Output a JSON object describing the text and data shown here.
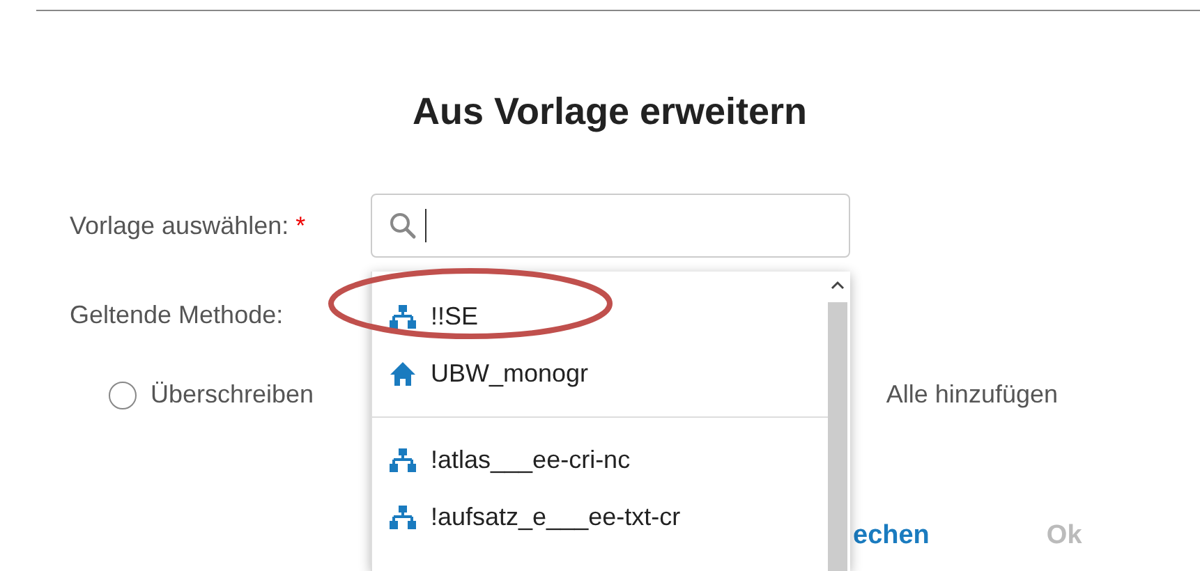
{
  "dialog": {
    "title": "Aus Vorlage erweitern"
  },
  "template_field": {
    "label": "Vorlage auswählen:",
    "required_mark": "*"
  },
  "dropdown": {
    "items": [
      {
        "kind": "tree",
        "label": "!!SE",
        "circled": true
      },
      {
        "kind": "home",
        "label": "UBW_monogr",
        "circled": false
      },
      {
        "kind": "separator"
      },
      {
        "kind": "tree",
        "label": "!atlas___ee-cri-nc",
        "circled": false
      },
      {
        "kind": "tree",
        "label": "!aufsatz_e___ee-txt-cr",
        "circled": false
      }
    ]
  },
  "method": {
    "label": "Geltende Methode:",
    "options": [
      {
        "label": "Überschreiben",
        "selected": false
      }
    ],
    "option_2_label": "Alle hinzufügen"
  },
  "buttons": [
    {
      "label": "echen",
      "disabled": false
    },
    {
      "label": "Ok",
      "disabled": true
    }
  ]
}
